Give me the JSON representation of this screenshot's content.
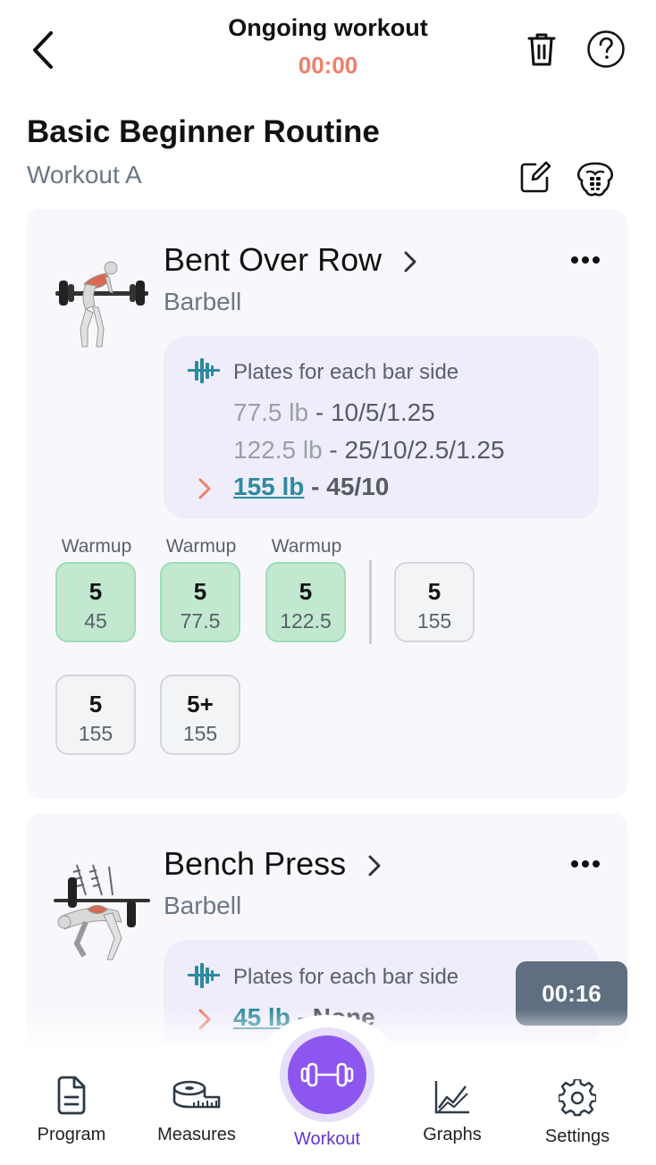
{
  "header": {
    "title": "Ongoing workout",
    "timer": "00:00"
  },
  "routine": {
    "title": "Basic Beginner Routine",
    "subtitle": "Workout A"
  },
  "exercises": [
    {
      "name": "Bent Over Row",
      "equipment": "Barbell",
      "plates_heading": "Plates for each bar side",
      "plate_rows": [
        {
          "weight": "77.5 lb",
          "sep": " - ",
          "plates": "10/5/1.25"
        },
        {
          "weight": "122.5 lb",
          "sep": " - ",
          "plates": "25/10/2.5/1.25"
        }
      ],
      "current_plate": {
        "weight": "155 lb",
        "sep": " - ",
        "plates": "45/10"
      },
      "sets": [
        {
          "label": "Warmup",
          "reps": "5",
          "weight": "45"
        },
        {
          "label": "Warmup",
          "reps": "5",
          "weight": "77.5"
        },
        {
          "label": "Warmup",
          "reps": "5",
          "weight": "122.5"
        },
        {
          "label": "",
          "reps": "5",
          "weight": "155"
        },
        {
          "label": "",
          "reps": "5",
          "weight": "155"
        },
        {
          "label": "",
          "reps": "5+",
          "weight": "155"
        }
      ]
    },
    {
      "name": "Bench Press",
      "equipment": "Barbell",
      "plates_heading": "Plates for each bar side",
      "current_plate": {
        "weight": "45 lb",
        "sep": " - ",
        "plates": "None"
      }
    }
  ],
  "rest_timer": "00:16",
  "nav": {
    "items": [
      {
        "label": "Program",
        "icon": "document-icon"
      },
      {
        "label": "Measures",
        "icon": "tape-measure-icon"
      },
      {
        "label": "Workout",
        "icon": "dumbbell-icon"
      },
      {
        "label": "Graphs",
        "icon": "line-graph-icon"
      },
      {
        "label": "Settings",
        "icon": "gear-icon"
      }
    ]
  },
  "colors": {
    "accent": "#8d56ef",
    "timer": "#f07f6a",
    "warmup_fill": "#c2e8d0",
    "link": "#2d8aa0"
  }
}
